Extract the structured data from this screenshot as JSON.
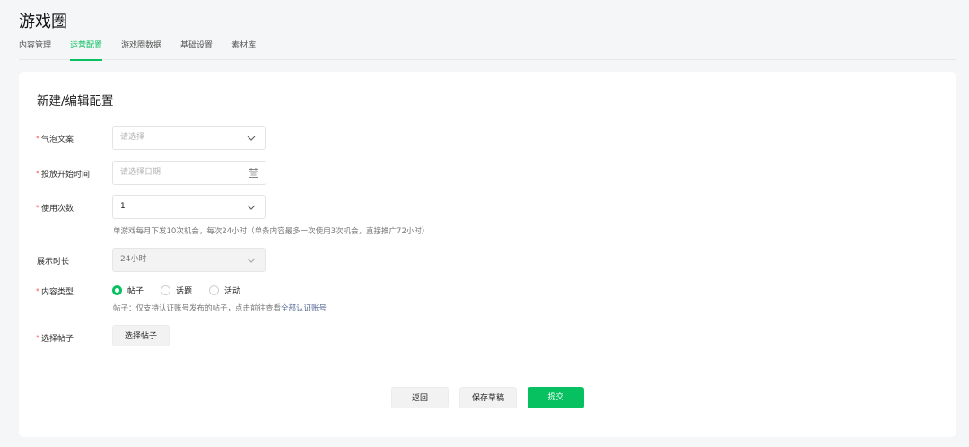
{
  "header": {
    "title": "游戏圈",
    "tabs": [
      {
        "label": "内容管理",
        "active": false
      },
      {
        "label": "运营配置",
        "active": true
      },
      {
        "label": "游戏圈数据",
        "active": false
      },
      {
        "label": "基础设置",
        "active": false
      },
      {
        "label": "素材库",
        "active": false
      }
    ]
  },
  "form": {
    "title": "新建/编辑配置",
    "required_mark": "*",
    "bubble_copy": {
      "label": "气泡文案",
      "placeholder": "请选择"
    },
    "start_time": {
      "label": "投放开始时间",
      "placeholder": "请选择日期"
    },
    "use_count": {
      "label": "使用次数",
      "value": "1",
      "hint": "单游戏每月下发10次机会，每次24小时（单条内容最多一次使用3次机会，直接推广72小时）"
    },
    "display_duration": {
      "label": "展示时长",
      "value": "24小时"
    },
    "content_type": {
      "label": "内容类型",
      "options": [
        {
          "label": "帖子",
          "selected": true
        },
        {
          "label": "话题",
          "selected": false
        },
        {
          "label": "活动",
          "selected": false
        }
      ],
      "hint": "帖子：仅支持认证账号发布的帖子，点击前往查看",
      "hint_link": "全部认证账号"
    },
    "select_post": {
      "label": "选择帖子",
      "button": "选择帖子"
    }
  },
  "actions": {
    "back": "返回",
    "save_draft": "保存草稿",
    "submit": "提交"
  },
  "colors": {
    "accent": "#07c160",
    "required": "#fa5151",
    "link": "#576b95"
  }
}
